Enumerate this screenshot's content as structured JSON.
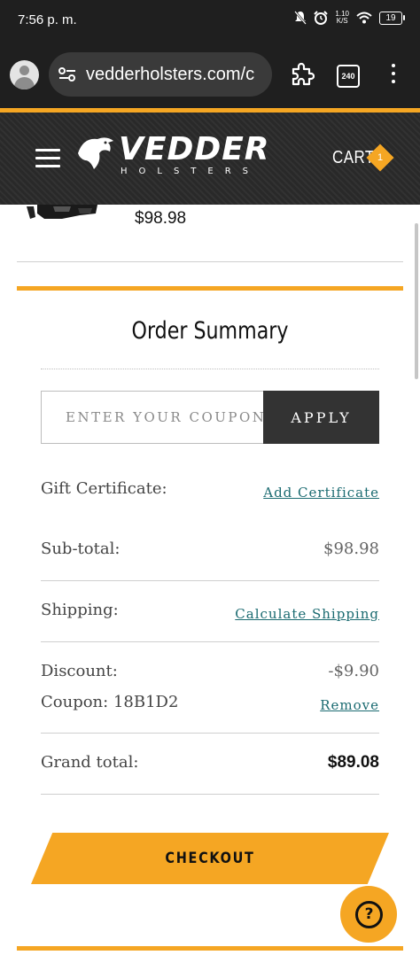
{
  "status_bar": {
    "time": "7:56 p. m.",
    "net_speed_value": "1.10",
    "net_speed_unit": "K/S",
    "battery": "19"
  },
  "browser": {
    "url": "vedderholsters.com/c",
    "tab_count": "240"
  },
  "site": {
    "logo_word": "VEDDER",
    "logo_sub": "HOLSTERS",
    "cart_label": "CART",
    "cart_count": "1"
  },
  "product": {
    "price": "$98.98"
  },
  "order_summary": {
    "title": "Order Summary",
    "coupon_placeholder": "ENTER YOUR COUPON CODE",
    "apply_label": "APPLY",
    "gift_label": "Gift Certificate:",
    "gift_link": "Add Certificate",
    "subtotal_label": "Sub-total:",
    "subtotal_value": "$98.98",
    "shipping_label": "Shipping:",
    "shipping_link": "Calculate Shipping",
    "discount_label": "Discount:",
    "discount_value": "-$9.90",
    "coupon_label": "Coupon: 18B1D2",
    "remove_link": "Remove",
    "grand_label": "Grand total:",
    "grand_value": "$89.08",
    "checkout_label": "CHECKOUT",
    "help_icon_text": "?"
  },
  "colors": {
    "accent": "#f5a623",
    "dark": "#2b2b2b",
    "link": "#1b6b71"
  }
}
